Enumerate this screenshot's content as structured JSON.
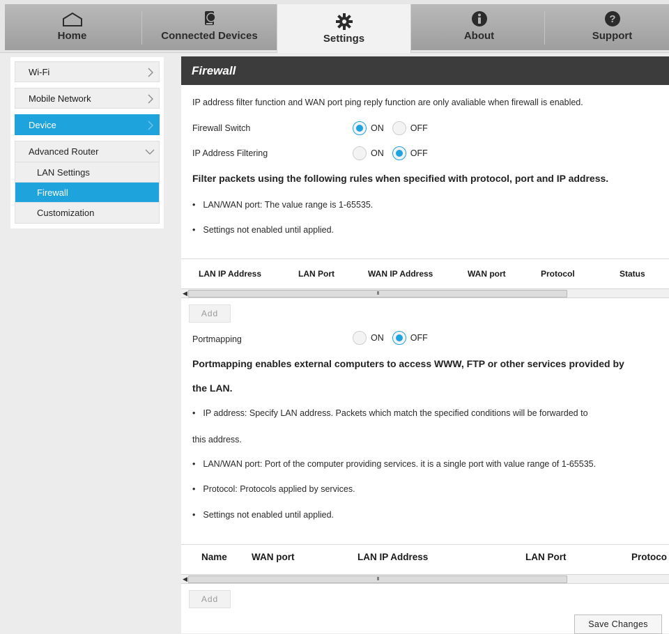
{
  "nav": {
    "tabs": [
      {
        "label": "Home",
        "icon": "home-icon"
      },
      {
        "label": "Connected Devices",
        "icon": "device-icon"
      },
      {
        "label": "Settings",
        "icon": "gear-icon"
      },
      {
        "label": "About",
        "icon": "info-icon"
      },
      {
        "label": "Support",
        "icon": "help-icon"
      }
    ],
    "active": "Settings"
  },
  "sidebar": {
    "items": [
      {
        "label": "Wi-Fi"
      },
      {
        "label": "Mobile Network"
      },
      {
        "label": "Device"
      }
    ],
    "group": {
      "label": "Advanced Router",
      "children": [
        {
          "label": "LAN Settings"
        },
        {
          "label": "Firewall"
        },
        {
          "label": "Customization"
        }
      ]
    }
  },
  "main": {
    "title": "Firewall",
    "intro": "IP address filter function and WAN port ping reply function are only avaliable when firewall is enabled.",
    "firewall_switch": {
      "label": "Firewall Switch",
      "on": "ON",
      "off": "OFF",
      "value": "ON"
    },
    "ip_filtering": {
      "label": "IP Address Filtering",
      "on": "ON",
      "off": "OFF",
      "value": "OFF"
    },
    "filter_heading": "Filter packets using the following rules when specified with protocol, port and IP address.",
    "filter_notes": [
      "LAN/WAN port: The value range is 1-65535.",
      "Settings not enabled until applied."
    ],
    "filter_table": {
      "headers": [
        "LAN IP Address",
        "LAN Port",
        "WAN IP Address",
        "WAN port",
        "Protocol",
        "Status"
      ]
    },
    "add_label": "Add",
    "portmapping": {
      "label": "Portmapping",
      "on": "ON",
      "off": "OFF",
      "value": "OFF"
    },
    "pm_heading_1": "Portmapping enables external computers to access WWW, FTP or other services provided by",
    "pm_heading_2": "the LAN.",
    "pm_note_ip_1": "IP address: Specify LAN address. Packets which match the specified conditions will be forwarded to",
    "pm_note_ip_2": "this address.",
    "pm_notes": [
      "LAN/WAN port: Port of the computer providing services. it is a single port with value range of 1-65535.",
      "Protocol: Protocols applied by services.",
      "Settings not enabled until applied."
    ],
    "pm_table": {
      "headers": [
        "Name",
        "WAN port",
        "LAN IP Address",
        "LAN Port",
        "Protoco"
      ]
    },
    "scroll_grip": "III",
    "save_label": "Save Changes"
  }
}
